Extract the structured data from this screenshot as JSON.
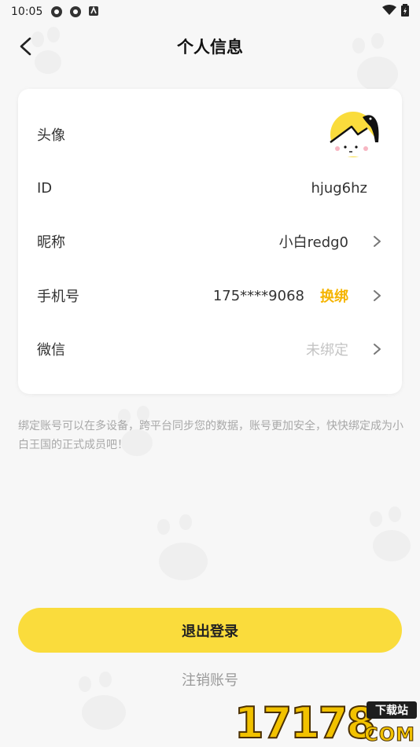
{
  "status_bar": {
    "time": "10:05"
  },
  "header": {
    "title": "个人信息"
  },
  "profile": {
    "avatar_label": "头像",
    "id_label": "ID",
    "id_value": "hjug6hz",
    "nickname_label": "昵称",
    "nickname_value": "小白redg0",
    "phone_label": "手机号",
    "phone_value": "175****9068",
    "phone_rebind": "换绑",
    "wechat_label": "微信",
    "wechat_value": "未绑定"
  },
  "note": "绑定账号可以在多设备，跨平台同步您的数据，账号更加安全，快快绑定成为小白王国的正式成员吧！",
  "actions": {
    "logout_label": "退出登录",
    "cancel_account_label": "注销账号"
  },
  "watermark": {
    "digits": "17178",
    "tag": "下载站",
    "com": "COM"
  },
  "colors": {
    "accent": "#fadc3c",
    "rebind": "#f5b400",
    "background": "#f7f7f7",
    "card": "#ffffff"
  }
}
